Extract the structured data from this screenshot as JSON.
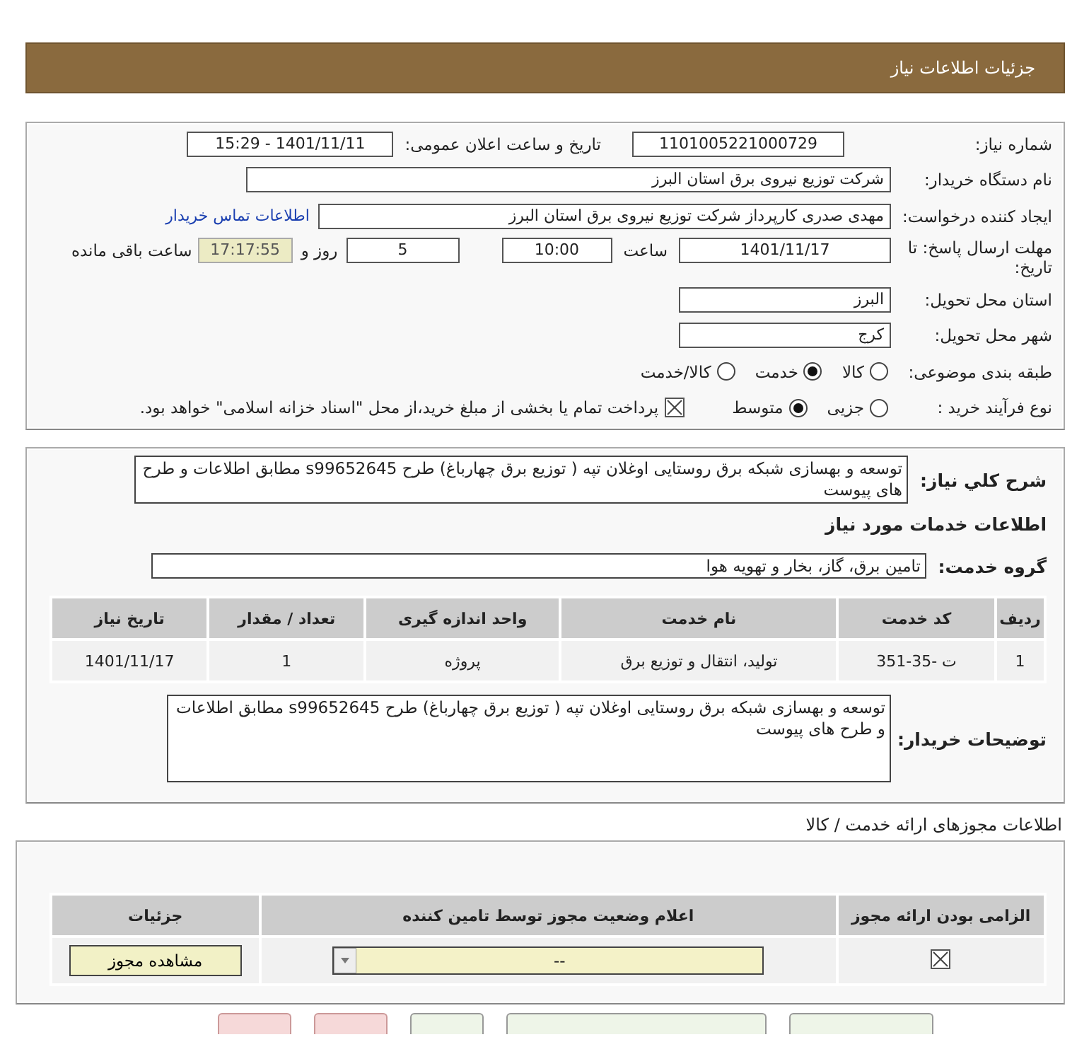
{
  "header": {
    "title": "جزئیات اطلاعات نیاز"
  },
  "details": {
    "need_number": {
      "label": "شماره نیاز:",
      "value": "1101005221000729"
    },
    "announce": {
      "label": "تاریخ و ساعت اعلان عمومی:",
      "value": "1401/11/11 - 15:29"
    },
    "buyer": {
      "label": "نام دستگاه خریدار:",
      "value": "شرکت توزیع نیروی برق استان البرز"
    },
    "creator": {
      "label": "ایجاد کننده درخواست:",
      "value": "مهدی صدری کارپرداز شرکت توزیع نیروی برق استان البرز",
      "link": "اطلاعات تماس خریدار"
    },
    "deadline": {
      "label": "مهلت ارسال پاسخ: تا تاریخ:",
      "date": "1401/11/17",
      "time_label": "ساعت",
      "time": "10:00",
      "days": "5",
      "days_label": "روز و",
      "remaining": "17:17:55",
      "remaining_label": "ساعت باقی مانده"
    },
    "province": {
      "label": "استان محل تحویل:",
      "value": "البرز"
    },
    "city": {
      "label": "شهر محل تحویل:",
      "value": "کرج"
    },
    "category": {
      "label": "طبقه بندی موضوعی:",
      "options": [
        {
          "label": "کالا",
          "selected": false
        },
        {
          "label": "خدمت",
          "selected": true
        },
        {
          "label": "کالا/خدمت",
          "selected": false
        }
      ]
    },
    "process": {
      "label": "نوع فرآیند خرید :",
      "options": [
        {
          "label": "جزیی",
          "selected": false
        },
        {
          "label": "متوسط",
          "selected": true
        }
      ],
      "payment": {
        "label": "پرداخت تمام یا بخشی از مبلغ خرید،از محل \"اسناد خزانه اسلامی\" خواهد بود.",
        "checked": true
      }
    }
  },
  "needs": {
    "description": {
      "label": "شرح کلي نياز:",
      "value": "توسعه و بهسازی شبکه برق روستایی اوغلان تپه ( توزیع برق چهارباغ)  طرح s99652645   مطابق اطلاعات و طرح های پیوست"
    },
    "section_title": "اطلاعات خدمات مورد نیاز",
    "group": {
      "label": "گروه خدمت:",
      "value": "تامین برق، گاز، بخار و تهویه هوا"
    },
    "table": {
      "columns": [
        "ردیف",
        "کد خدمت",
        "نام خدمت",
        "واحد اندازه گیری",
        "تعداد / مقدار",
        "تاریخ نیاز"
      ],
      "rows": [
        [
          "1",
          "ت -35-351",
          "تولید، انتقال و توزیع برق",
          "پروژه",
          "1",
          "1401/11/17"
        ]
      ]
    },
    "buyer_notes": {
      "label": "توضیحات خریدار:",
      "value": "توسعه و بهسازی شبکه برق روستایی اوغلان تپه ( توزیع برق چهارباغ)  طرح s99652645   مطابق اطلاعات و طرح های پیوست"
    }
  },
  "licenses": {
    "title": "اطلاعات مجوزهای ارائه خدمت / کالا",
    "columns": [
      "الزامی بودن ارائه مجوز",
      "اعلام وضعیت مجوز توسط تامین کننده",
      "جزئیات"
    ],
    "rows": [
      {
        "required": true,
        "status": "--",
        "button": "مشاهده مجوز"
      }
    ]
  },
  "footer_buttons": [
    {
      "kind": "plain"
    },
    {
      "kind": "plain"
    },
    {
      "kind": "plain"
    },
    {
      "kind": "danger"
    },
    {
      "kind": "danger"
    }
  ]
}
